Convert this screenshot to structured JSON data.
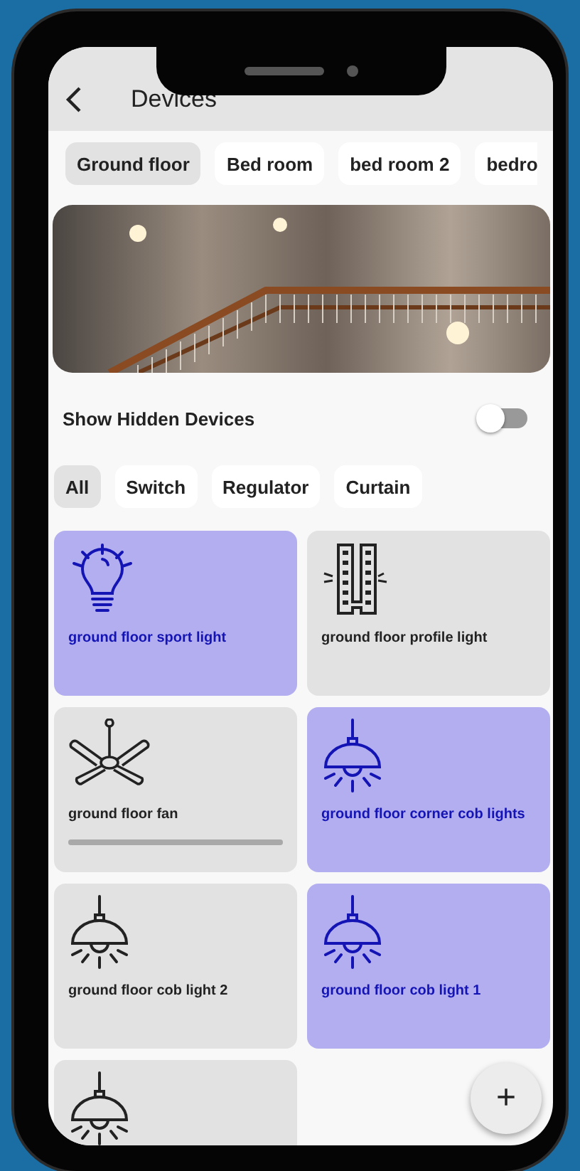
{
  "app_bar": {
    "title": "Devices"
  },
  "rooms": [
    {
      "label": "Ground floor",
      "selected": true
    },
    {
      "label": "Bed room",
      "selected": false
    },
    {
      "label": "bed room 2",
      "selected": false
    },
    {
      "label": "bedro",
      "selected": false
    }
  ],
  "show_hidden": {
    "label": "Show Hidden Devices",
    "on": false
  },
  "filters": [
    {
      "label": "All",
      "selected": true
    },
    {
      "label": "Switch",
      "selected": false
    },
    {
      "label": "Regulator",
      "selected": false
    },
    {
      "label": "Curtain",
      "selected": false
    }
  ],
  "devices": [
    {
      "kind": "bulb",
      "name": "ground floor sport light",
      "on": true
    },
    {
      "kind": "strip",
      "name": "ground floor profile light",
      "on": false
    },
    {
      "kind": "fan",
      "name": "ground floor fan",
      "on": false,
      "level": 1
    },
    {
      "kind": "pendant",
      "name": "ground floor corner cob lights",
      "on": true
    },
    {
      "kind": "pendant",
      "name": "ground floor cob light 2",
      "on": false
    },
    {
      "kind": "pendant",
      "name": "ground floor cob light 1",
      "on": true
    },
    {
      "kind": "pendant",
      "on": false
    }
  ],
  "fab": {
    "label": "+"
  }
}
